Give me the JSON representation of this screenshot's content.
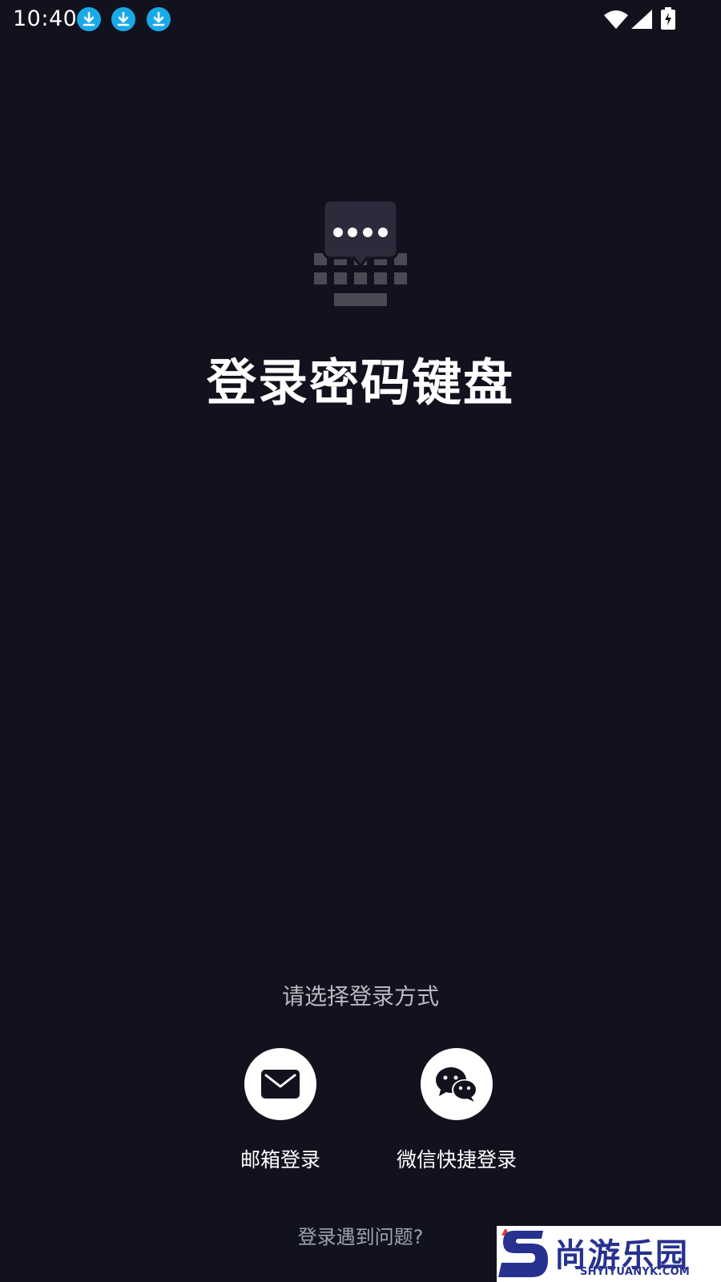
{
  "status_bar": {
    "time": "10:40",
    "notification_icons": [
      "download-icon",
      "download-icon",
      "download-icon"
    ],
    "indicators": [
      "wifi-icon",
      "signal-icon",
      "battery-charging-icon"
    ]
  },
  "header": {
    "logo_icon": "keyboard-password-icon",
    "title": "登录密码键盘"
  },
  "login": {
    "prompt": "请选择登录方式",
    "options": [
      {
        "icon": "mail-icon",
        "label": "邮箱登录"
      },
      {
        "icon": "wechat-icon",
        "label": "微信快捷登录"
      }
    ],
    "help_link": "登录遇到问题?"
  },
  "watermark": {
    "text": "尚游乐园",
    "subtext": "SHYIYUANYK.COM"
  },
  "colors": {
    "background": "#12121e",
    "accent_download": "#1aa9e8",
    "watermark_blue": "#27318f"
  }
}
